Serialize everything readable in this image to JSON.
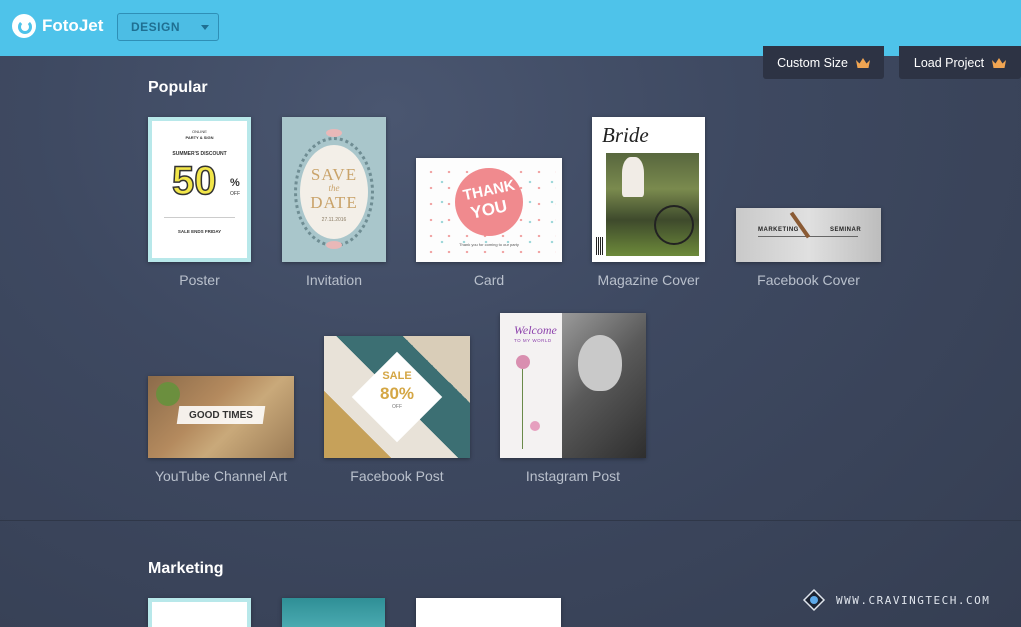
{
  "app": {
    "name": "FotoJet"
  },
  "mode_select": {
    "value": "DESIGN"
  },
  "actions": {
    "custom_size": "Custom Size",
    "load_project": "Load Project"
  },
  "sections": {
    "popular": "Popular",
    "marketing": "Marketing"
  },
  "templates": {
    "poster": {
      "label": "Poster",
      "small1": "ONLINE",
      "small2": "PARTY & SIGN",
      "discount": "SUMMER'S DISCOUNT",
      "big": "50",
      "pct": "%",
      "off": "OFF",
      "sale": "SALE ENDS FRIDAY"
    },
    "invitation": {
      "label": "Invitation",
      "l1": "SAVE",
      "l2": "the",
      "l3": "DATE",
      "date": "27.11.2016"
    },
    "card": {
      "label": "Card",
      "l1": "THANK",
      "l2": "YOU",
      "msg": "Thank you for coming to our party"
    },
    "magazine": {
      "label": "Magazine Cover",
      "title": "Bride"
    },
    "fb_cover": {
      "label": "Facebook Cover",
      "t1": "MARKETING",
      "t2": "SEMINAR"
    },
    "yt_art": {
      "label": "YouTube Channel Art",
      "t1": "GOOD TIMES"
    },
    "fb_post": {
      "label": "Facebook Post",
      "t1": "SALE",
      "t2": "80%",
      "t3": "OFF"
    },
    "ig_post": {
      "label": "Instagram Post",
      "t1": "Welcome",
      "t2": "TO MY WORLD"
    }
  },
  "watermark": {
    "text": "WWW.CRAVINGTECH.COM"
  },
  "colors": {
    "topbar": "#4ec3ea",
    "crown": "#f0a552",
    "background": "#3e4961"
  }
}
